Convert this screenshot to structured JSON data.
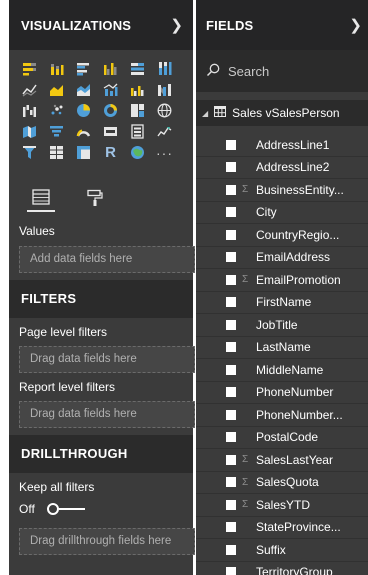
{
  "visualizations": {
    "title": "VISUALIZATIONS",
    "collapse_icon": "chevron-right-icon",
    "icons": [
      {
        "name": "stacked-bar-chart-icon"
      },
      {
        "name": "stacked-column-chart-icon"
      },
      {
        "name": "clustered-bar-chart-icon"
      },
      {
        "name": "clustered-column-chart-icon"
      },
      {
        "name": "100-stacked-bar-chart-icon"
      },
      {
        "name": "100-stacked-column-chart-icon"
      },
      {
        "name": "line-chart-icon"
      },
      {
        "name": "area-chart-icon"
      },
      {
        "name": "stacked-area-chart-icon"
      },
      {
        "name": "line-and-stacked-column-chart-icon"
      },
      {
        "name": "line-and-clustered-column-chart-icon"
      },
      {
        "name": "ribbon-chart-icon"
      },
      {
        "name": "waterfall-chart-icon"
      },
      {
        "name": "scatter-chart-icon"
      },
      {
        "name": "pie-chart-icon"
      },
      {
        "name": "donut-chart-icon"
      },
      {
        "name": "treemap-icon"
      },
      {
        "name": "map-icon"
      },
      {
        "name": "filled-map-icon"
      },
      {
        "name": "funnel-icon"
      },
      {
        "name": "gauge-icon"
      },
      {
        "name": "card-icon"
      },
      {
        "name": "multi-row-card-icon"
      },
      {
        "name": "kpi-icon"
      },
      {
        "name": "slicer-icon"
      },
      {
        "name": "table-icon"
      },
      {
        "name": "matrix-icon"
      },
      {
        "name": "r-script-visual-icon",
        "glyph": "R"
      },
      {
        "name": "arcgis-map-icon"
      },
      {
        "name": "more-visuals-icon",
        "glyph": "···"
      }
    ],
    "tools": [
      {
        "name": "fields-well-icon",
        "active": true
      },
      {
        "name": "format-paint-roller-icon",
        "active": false
      }
    ],
    "values_label": "Values",
    "values_placeholder": "Add data fields here"
  },
  "filters": {
    "title": "FILTERS",
    "page_level_label": "Page level filters",
    "page_level_placeholder": "Drag data fields here",
    "report_level_label": "Report level filters",
    "report_level_placeholder": "Drag data fields here"
  },
  "drillthrough": {
    "title": "DRILLTHROUGH",
    "keep_all_filters_label": "Keep all filters",
    "toggle_state_label": "Off",
    "toggle_on": false,
    "placeholder": "Drag drillthrough fields here"
  },
  "fields": {
    "title": "FIELDS",
    "collapse_icon": "chevron-right-icon",
    "search_placeholder": "Search",
    "table_name": "Sales vSalesPerson",
    "items": [
      {
        "label": "AddressLine1",
        "sigma": false
      },
      {
        "label": "AddressLine2",
        "sigma": false
      },
      {
        "label": "BusinessEntity...",
        "sigma": true
      },
      {
        "label": "City",
        "sigma": false
      },
      {
        "label": "CountryRegio...",
        "sigma": false
      },
      {
        "label": "EmailAddress",
        "sigma": false
      },
      {
        "label": "EmailPromotion",
        "sigma": true
      },
      {
        "label": "FirstName",
        "sigma": false
      },
      {
        "label": "JobTitle",
        "sigma": false
      },
      {
        "label": "LastName",
        "sigma": false
      },
      {
        "label": "MiddleName",
        "sigma": false
      },
      {
        "label": "PhoneNumber",
        "sigma": false
      },
      {
        "label": "PhoneNumber...",
        "sigma": false
      },
      {
        "label": "PostalCode",
        "sigma": false
      },
      {
        "label": "SalesLastYear",
        "sigma": true
      },
      {
        "label": "SalesQuota",
        "sigma": true
      },
      {
        "label": "SalesYTD",
        "sigma": true
      },
      {
        "label": "StateProvince...",
        "sigma": false
      },
      {
        "label": "Suffix",
        "sigma": false
      },
      {
        "label": "TerritoryGroup",
        "sigma": false
      }
    ]
  },
  "colors": {
    "pane_background": "#3b3b3b",
    "header_background": "#252526",
    "section_background": "#2b2b2b",
    "accent_blue": "#4f9fd8",
    "accent_yellow": "#f2c811"
  }
}
